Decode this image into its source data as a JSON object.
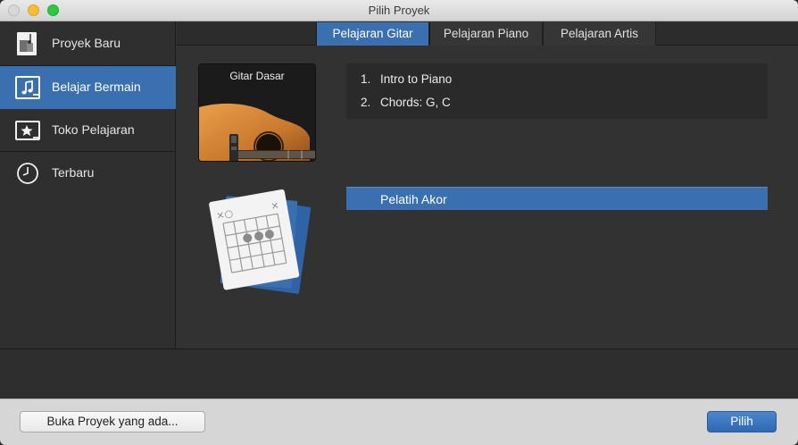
{
  "window": {
    "title": "Pilih Proyek"
  },
  "sidebar": {
    "items": [
      {
        "label": "Proyek Baru",
        "icon": "new-project-icon"
      },
      {
        "label": "Belajar Bermain",
        "icon": "music-note-icon",
        "selected": true
      },
      {
        "label": "Toko Pelajaran",
        "icon": "star-icon"
      },
      {
        "label": "Terbaru",
        "icon": "clock-icon"
      }
    ]
  },
  "tabs": [
    {
      "label": "Pelajaran Gitar",
      "selected": true
    },
    {
      "label": "Pelajaran Piano"
    },
    {
      "label": "Pelajaran Artis"
    }
  ],
  "lesson_card": {
    "title": "Gitar Dasar"
  },
  "lessons": [
    {
      "num": "1.",
      "label": "Intro to Piano"
    },
    {
      "num": "2.",
      "label": "Chords: G, C"
    }
  ],
  "chord_trainer": {
    "label": "Pelatih Akor"
  },
  "footer": {
    "open_label": "Buka Proyek yang ada...",
    "choose_label": "Pilih"
  },
  "colors": {
    "accent": "#3a6fb0",
    "background": "#323232",
    "sidebar": "#2f2f2f"
  }
}
